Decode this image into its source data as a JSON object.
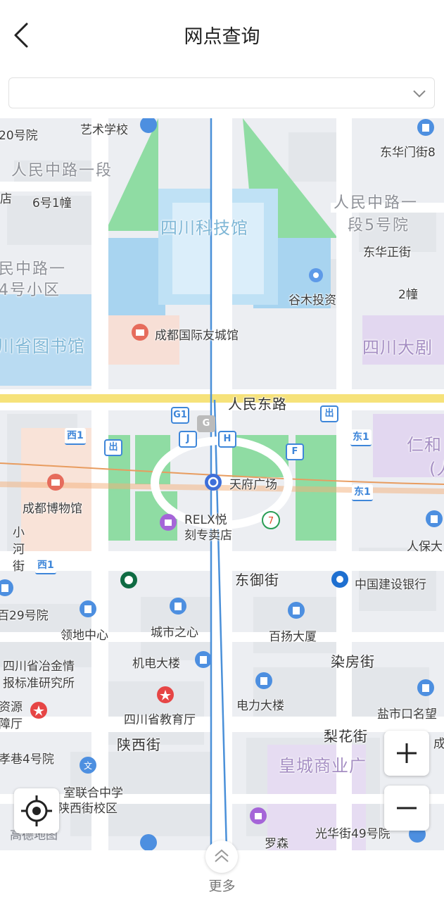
{
  "header": {
    "title": "网点查询"
  },
  "branch_select": {
    "value": ""
  },
  "map": {
    "labels": {
      "l1": "艺术学校",
      "l2": "20号院",
      "l3": "人民中路一段",
      "l4": "6号1幢",
      "l5": "店",
      "l6": "四川科技馆",
      "l7": "人民中路一",
      "l8": "段5号院",
      "l9": "东华门街8",
      "l10": "东华正街",
      "l11": "民中路一",
      "l12": "4号小区",
      "l13": "谷木投资",
      "l14": "2幢",
      "l15": "川省图书馆",
      "l16": "成都国际友城馆",
      "l17": "四川大剧",
      "l18": "人民东路",
      "l19": "仁和",
      "l20": "(人",
      "l21": "天府广场",
      "l22": "成都博物馆",
      "l23": "RELX悦",
      "l24": "刻专卖店",
      "l25": "小",
      "l26": "河",
      "l27": "街",
      "l28": "人保大",
      "l29": "东御街",
      "l30": "中国建设银行",
      "l31": "百29号院",
      "l32": "领地中心",
      "l33": "城市之心",
      "l34": "百扬大厦",
      "l35": "四川省冶金情",
      "l36": "报标准研究所",
      "l37": "机电大楼",
      "l38": "染房街",
      "l39": "资源",
      "l40": "障厅",
      "l41": "四川省教育厅",
      "l42": "电力大楼",
      "l43": "盐市口名望",
      "l44": "陕西街",
      "l45": "梨花街",
      "l46": "成",
      "l47": "孝巷4号院",
      "l48": "皇城商业广",
      "l49": "室联合中学",
      "l50": "陕西街校区",
      "l51": "罗森",
      "l52": "光华街49号院"
    },
    "metro": {
      "g1": "G1",
      "j": "J",
      "h": "H",
      "f": "F",
      "g": "G",
      "exit": "出",
      "w1": "西1",
      "w1b": "西1",
      "e1": "东1",
      "e1b": "东1"
    },
    "watermark": "高德地图"
  },
  "controls": {
    "zoom_in": "+",
    "zoom_out": "−"
  },
  "footer": {
    "more_label": "更多"
  },
  "colors": {
    "park": "#8fdca3",
    "water": "#a8d4f0",
    "road": "#ffffff",
    "major_road": "#f6e27a",
    "metro_line": "#4a90d9",
    "accent": "#3e86d9"
  }
}
